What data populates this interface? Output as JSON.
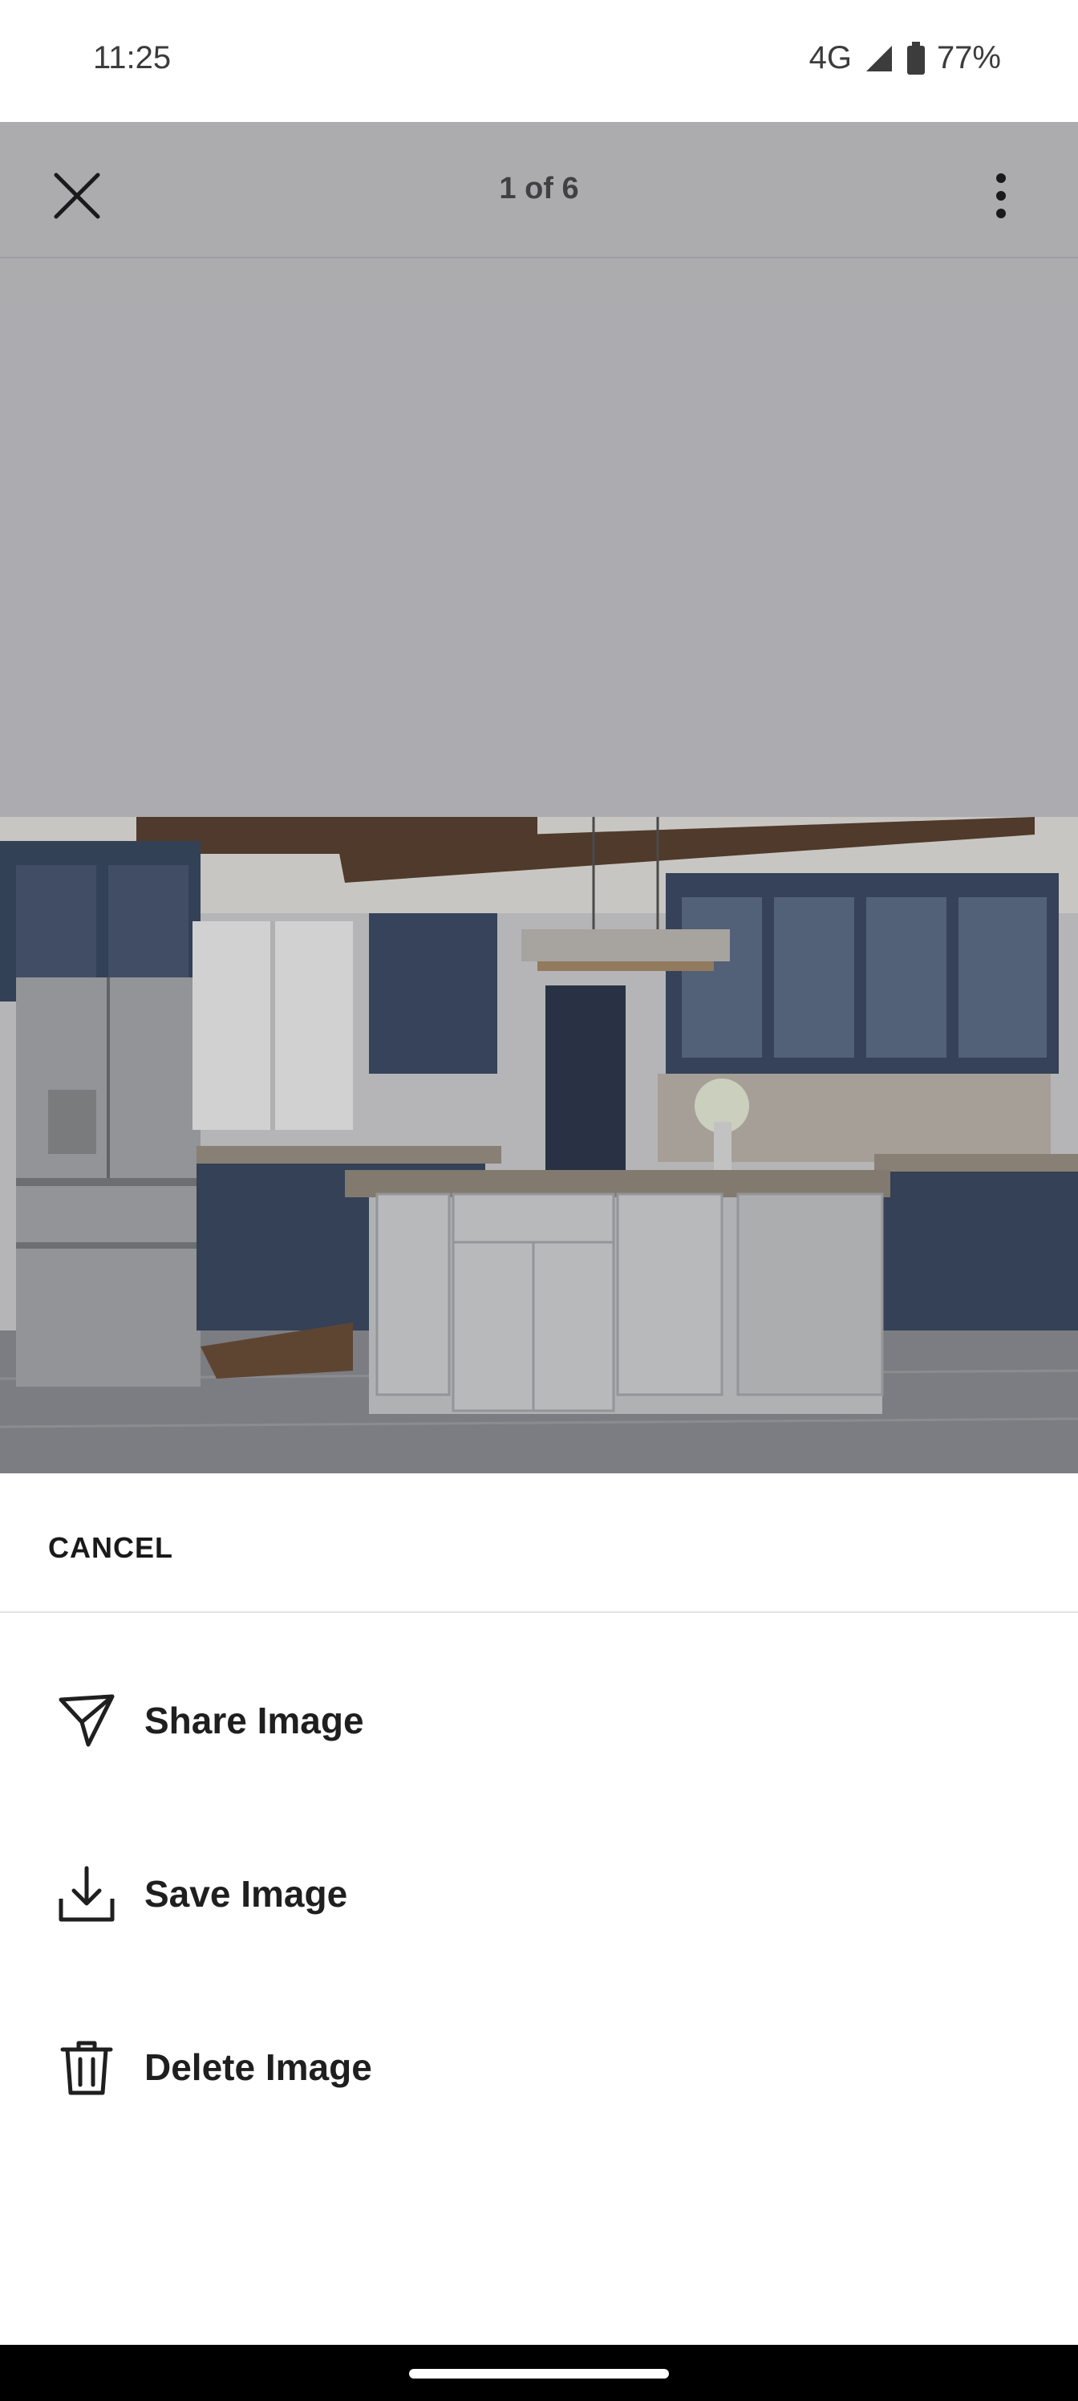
{
  "status_bar": {
    "time": "11:25",
    "network": "4G",
    "battery": "77%"
  },
  "viewer": {
    "counter": "1 of 6",
    "close_icon": "close-icon",
    "more_icon": "more-vert-icon",
    "photo_subject": "kitchen-photo"
  },
  "sheet": {
    "cancel_label": "CANCEL",
    "actions": [
      {
        "label": "Share Image",
        "icon": "send-icon"
      },
      {
        "label": "Save Image",
        "icon": "download-icon"
      },
      {
        "label": "Delete Image",
        "icon": "trash-icon"
      }
    ]
  },
  "colors": {
    "scrim": "#c4c4c8",
    "sheet_bg": "#ffffff",
    "text": "#1f1f1f",
    "navbar": "#000000"
  }
}
